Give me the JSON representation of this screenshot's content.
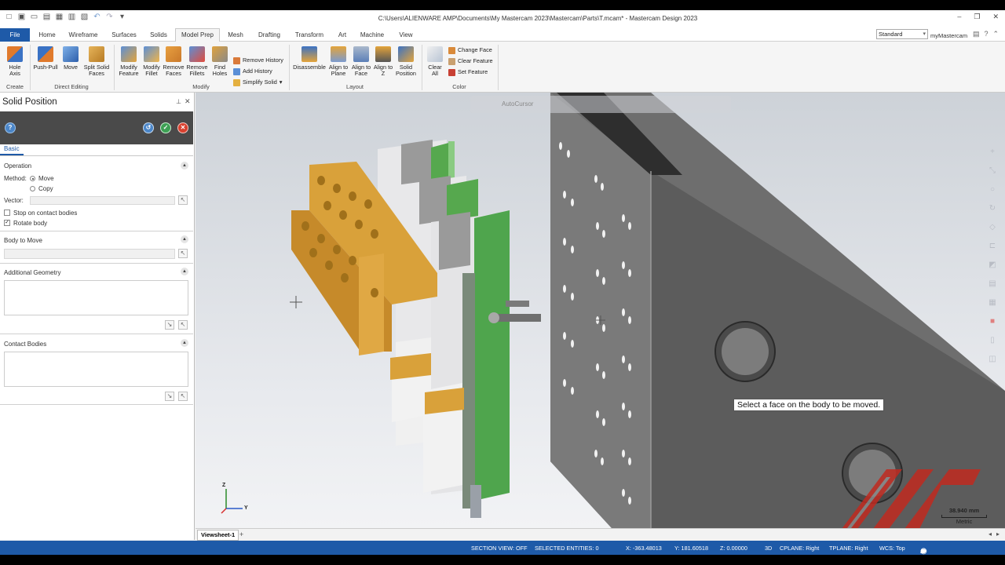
{
  "titlebar": {
    "title": "C:\\Users\\ALIENWARE AMP\\Documents\\My Mastercam 2023\\Mastercam\\Parts\\T.mcam* - Mastercam Design 2023"
  },
  "tabs": [
    "File",
    "Home",
    "Wireframe",
    "Surfaces",
    "Solids",
    "Model Prep",
    "Mesh",
    "Drafting",
    "Transform",
    "Art",
    "Machine",
    "View"
  ],
  "active_tab": "Model Prep",
  "workspace": {
    "selected": "Standard",
    "my_mastercam": "myMastercam"
  },
  "ribbon": {
    "create": {
      "hole_axis": "Hole Axis",
      "label": "Create"
    },
    "direct_editing": {
      "push_pull": "Push-Pull",
      "move": "Move",
      "split_solid_faces": "Split Solid Faces",
      "label": "Direct Editing"
    },
    "modify": {
      "modify_feature": "Modify Feature",
      "modify_fillet": "Modify Fillet",
      "remove_faces": "Remove Faces",
      "remove_fillets": "Remove Fillets",
      "find_holes": "Find Holes",
      "remove_history": "Remove History",
      "add_history": "Add History",
      "simplify_solid": "Simplify Solid",
      "label": "Modify"
    },
    "layout": {
      "disassemble": "Disassemble",
      "align_to_plane": "Align to Plane",
      "align_to_face": "Align to Face",
      "align_to_z": "Align to Z",
      "solid_position": "Solid Position",
      "label": "Layout"
    },
    "color": {
      "clear_all": "Clear All",
      "change_face": "Change Face",
      "clear_feature": "Clear Feature",
      "set_feature": "Set Feature",
      "label": "Color"
    }
  },
  "panel": {
    "title": "Solid Position",
    "tab": "Basic",
    "operation": {
      "header": "Operation",
      "method_label": "Method:",
      "method_options": [
        "Move",
        "Copy"
      ],
      "method_selected": "Move",
      "vector_label": "Vector:",
      "vector_value": "",
      "stop_on_contact": {
        "label": "Stop on contact bodies",
        "checked": false
      },
      "rotate_body": {
        "label": "Rotate body",
        "checked": true
      }
    },
    "body_to_move": {
      "header": "Body to Move",
      "value": ""
    },
    "additional_geometry": {
      "header": "Additional Geometry"
    },
    "contact_bodies": {
      "header": "Contact Bodies"
    }
  },
  "viewport": {
    "prompt": "Select a face on the body to be moved.",
    "autocursor": "AutoCursor",
    "scale_value": "38.940 mm",
    "scale_unit": "Metric",
    "axis_z": "Z",
    "axis_y": "Y"
  },
  "viewsheet": "Viewsheet-1",
  "status": {
    "section_view": "SECTION VIEW: OFF",
    "selected_entities": "SELECTED ENTITIES: 0",
    "x": "X:   -363.48013",
    "y": "Y:   181.60518",
    "z": "Z:   0.00000",
    "mode": "3D",
    "cplane": "CPLANE: Right",
    "tplane": "TPLANE: Right",
    "wcs": "WCS: Top"
  },
  "colors": {
    "accent": "#1e5aa8",
    "panel_bar": "#4a4a4a",
    "gold_part": "#d9a13a",
    "green_part": "#4fa54d",
    "plate": "#6b6b6b"
  }
}
